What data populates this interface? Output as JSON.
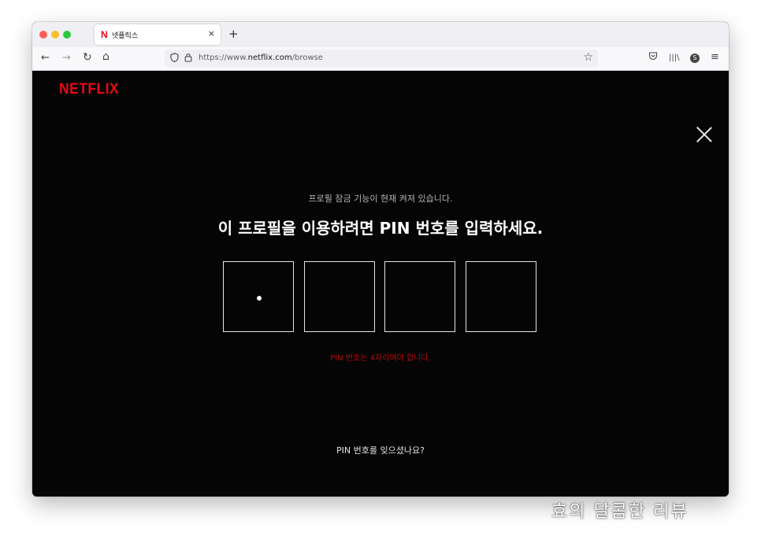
{
  "browser": {
    "tab": {
      "favicon": "N",
      "title": "넷플릭스",
      "close_glyph": "×"
    },
    "new_tab_glyph": "+",
    "nav": {
      "back_glyph": "←",
      "forward_glyph": "→",
      "reload_glyph": "↻",
      "home_glyph": "⌂"
    },
    "url": {
      "scheme": "https://www.",
      "host": "netflix.com",
      "path": "/browse"
    },
    "toolbar": {
      "pocket_glyph": "◡",
      "library_glyph": "|||\\",
      "avatar_glyph": "S",
      "menu_glyph": "≡"
    }
  },
  "page": {
    "logo": "NETFLIX",
    "status_text": "프로필 잠금 기능이 현재 켜져 있습니다.",
    "headline": "이 프로필을 이용하려면 PIN 번호를 입력하세요.",
    "pin_boxes": [
      {
        "filled": true
      },
      {
        "filled": false
      },
      {
        "filled": false
      },
      {
        "filled": false
      }
    ],
    "error_text": "PIN 번호는 4자리여야 합니다.",
    "forgot_link": "PIN 번호를 잊으셨나요?"
  },
  "watermark": "효의 달콤한 리뷰",
  "colors": {
    "brand_red": "#e50914",
    "error_red": "#b9090b",
    "background": "#050505"
  }
}
